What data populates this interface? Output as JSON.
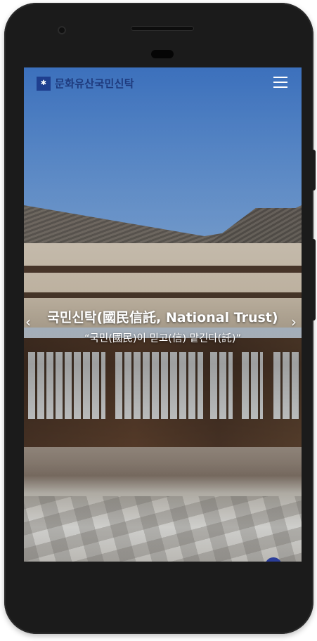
{
  "site": {
    "logo_text": "문화유산국민신탁",
    "logo_mark_icon": "emblem-icon"
  },
  "header": {
    "menu_icon": "hamburger-menu-icon"
  },
  "hero": {
    "title": "국민신탁(國民信託, National Trust)",
    "subtitle": "“국민(國民)이 믿고(信) 맡긴다(託)”",
    "prev_icon": "chevron-left-icon",
    "next_icon": "chevron-right-icon"
  },
  "colors": {
    "brand": "#1e3a7d",
    "logo_bg": "#1f3f8f",
    "text_on_image": "#ffffff",
    "device": "#1b1b1b"
  }
}
